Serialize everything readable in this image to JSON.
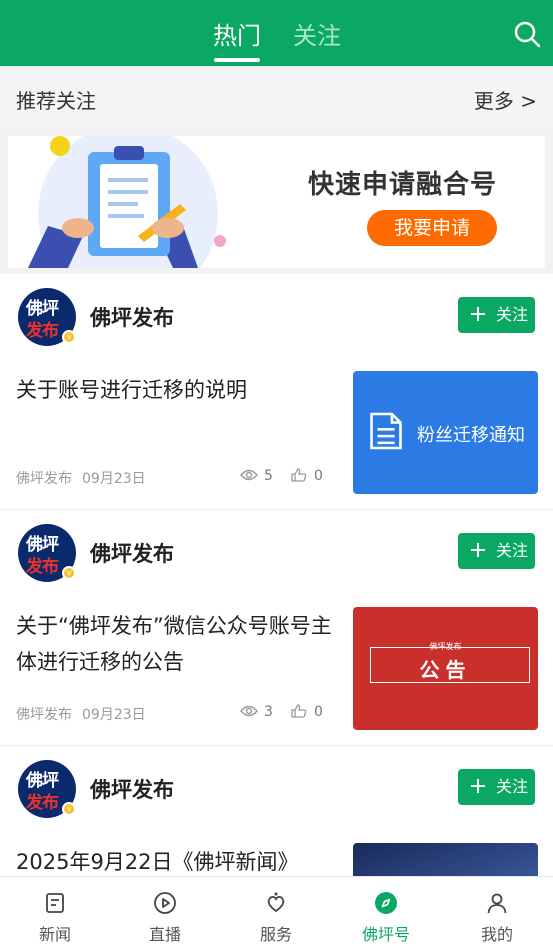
{
  "header": {
    "tabs": [
      {
        "label": "热门",
        "active": true
      },
      {
        "label": "关注",
        "active": false
      }
    ],
    "search_icon": "search-icon"
  },
  "recommend": {
    "title": "推荐关注",
    "more": "更多 >"
  },
  "banner": {
    "title": "快速申请融合号",
    "button": "我要申请"
  },
  "feed": [
    {
      "author": "佛坪发布",
      "avatar_line1": "佛坪",
      "avatar_line2": "发布",
      "follow": "关注",
      "title": "关于账号进行迁移的说明",
      "source": "佛坪发布",
      "date": "09月23日",
      "views": "5",
      "likes": "0",
      "thumb_text": "粉丝迁移通知"
    },
    {
      "author": "佛坪发布",
      "avatar_line1": "佛坪",
      "avatar_line2": "发布",
      "follow": "关注",
      "title": "关于“佛坪发布”微信公众号账号主体进行迁移的公告",
      "source": "佛坪发布",
      "date": "09月23日",
      "views": "3",
      "likes": "0",
      "thumb_small": "佛坪发布",
      "thumb_big": "公告"
    },
    {
      "author": "佛坪发布",
      "avatar_line1": "佛坪",
      "avatar_line2": "发布",
      "follow": "关注",
      "title": "2025年9月22日《佛坪新闻》"
    }
  ],
  "bottom_nav": [
    {
      "label": "新闻",
      "icon": "news-icon"
    },
    {
      "label": "直播",
      "icon": "play-icon"
    },
    {
      "label": "服务",
      "icon": "service-icon"
    },
    {
      "label": "佛坪号",
      "icon": "compass-icon",
      "active": true
    },
    {
      "label": "我的",
      "icon": "user-icon"
    }
  ],
  "colors": {
    "brand_green": "#0aa862",
    "banner_button": "#ff6a00",
    "avatar_navy": "#0b2a6e",
    "thumb_blue": "#2c7be5",
    "thumb_red": "#c9302c"
  }
}
